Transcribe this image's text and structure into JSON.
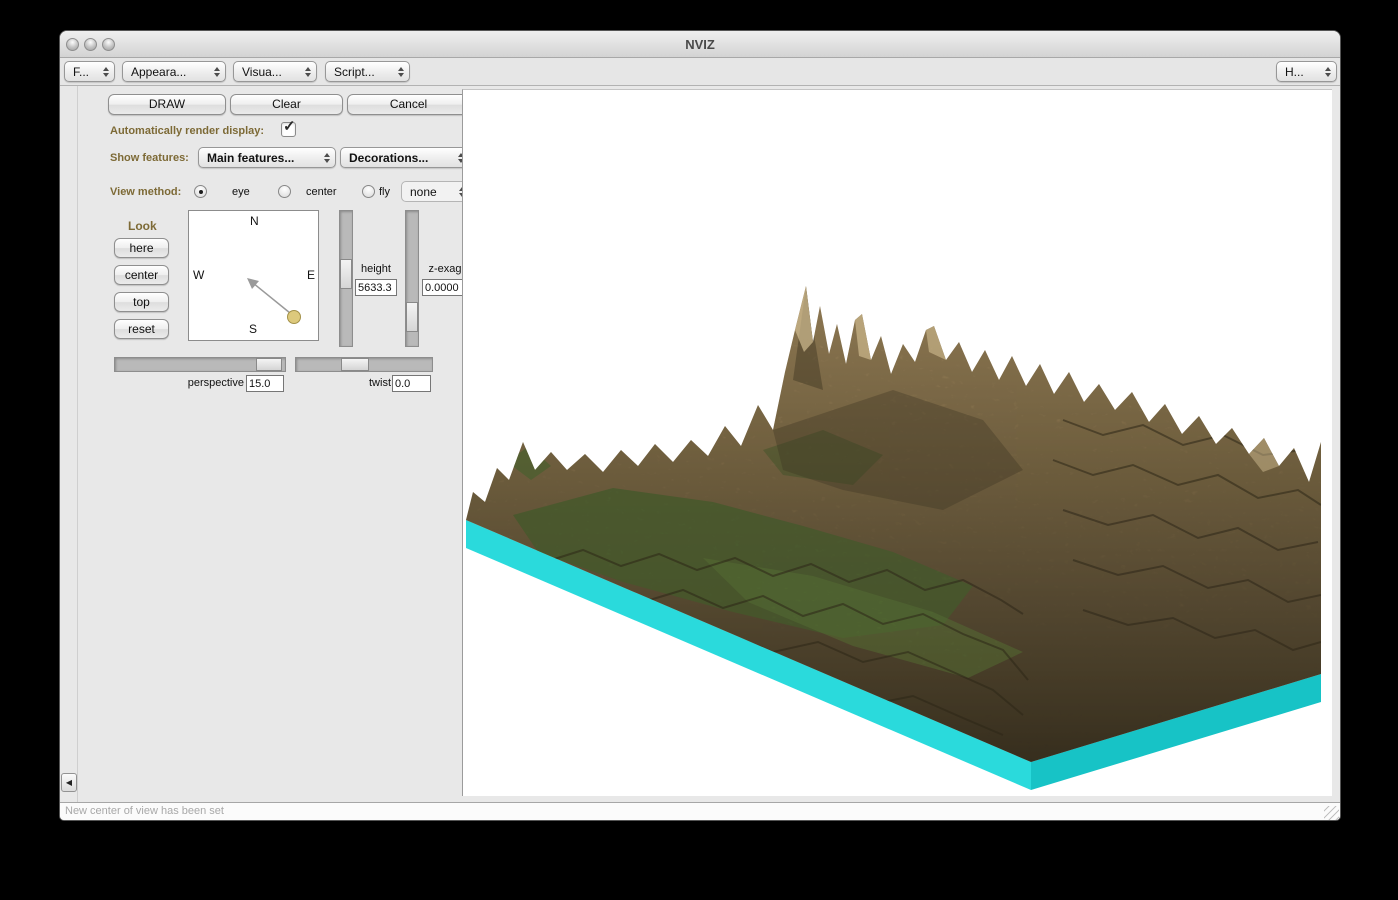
{
  "window": {
    "title": "NVIZ",
    "status_text": "New center of view has been set"
  },
  "menubar": {
    "file": "F...",
    "appearance": "Appeara...",
    "visualize": "Visua...",
    "scripting": "Script...",
    "help": "H..."
  },
  "panel": {
    "draw": "DRAW",
    "clear": "Clear",
    "cancel": "Cancel",
    "auto_render_label": "Automatically render display:",
    "auto_render_checked": true,
    "show_features_label": "Show features:",
    "main_features": "Main features...",
    "decorations": "Decorations...",
    "view_method_label": "View method:",
    "radio_eye": "eye",
    "radio_center": "center",
    "radio_fly": "fly",
    "view_method_selected": "eye",
    "fly_none": "none",
    "look_label": "Look",
    "btn_here": "here",
    "btn_center": "center",
    "btn_top": "top",
    "btn_reset": "reset",
    "compass": {
      "n": "N",
      "s": "S",
      "w": "W",
      "e": "E"
    },
    "height_label": "height",
    "height_value": "5633.3",
    "zexag_label": "z-exag",
    "zexag_value": "0.0000",
    "perspective_label": "perspective",
    "perspective_value": "15.0",
    "twist_label": "twist",
    "twist_value": "0.0"
  },
  "icons": {
    "collapse_arrow": "◀",
    "checkmark": "✓"
  },
  "colors": {
    "label_brown": "#7d6a36",
    "base_cyan_light": "#2adadc",
    "base_cyan_dark": "#17c3c6",
    "terrain_brown": "#85704a",
    "terrain_green": "#47672e"
  }
}
